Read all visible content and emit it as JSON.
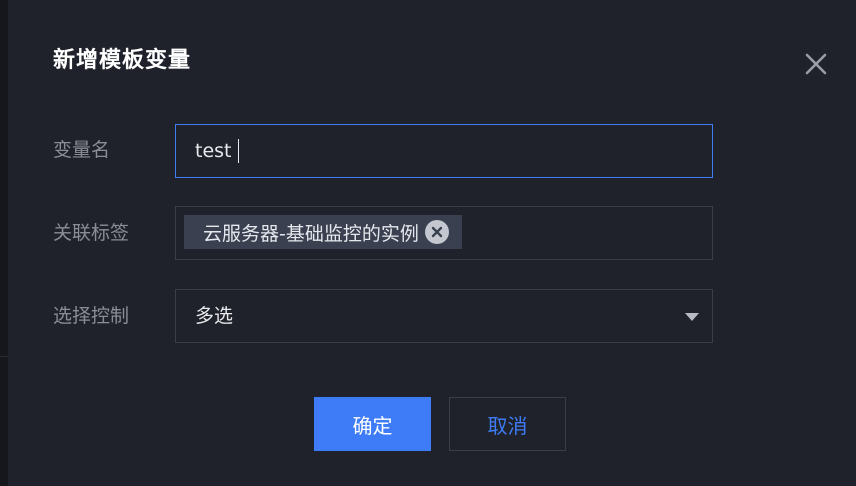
{
  "dialog": {
    "title": "新增模板变量",
    "close_icon": "close-icon"
  },
  "form": {
    "variable_name": {
      "label": "变量名",
      "value": "test"
    },
    "associated_tags": {
      "label": "关联标签",
      "tags": [
        "云服务器-基础监控的实例"
      ],
      "tag_remove_icon": "close-circle-icon"
    },
    "select_control": {
      "label": "选择控制",
      "value": "多选",
      "arrow_icon": "caret-down-icon"
    }
  },
  "actions": {
    "confirm_label": "确定",
    "cancel_label": "取消"
  },
  "colors": {
    "accent": "#3d7bf7",
    "background": "#20222b",
    "tag_bg": "#3a4050"
  }
}
